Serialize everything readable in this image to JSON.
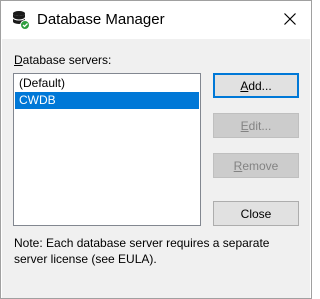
{
  "window": {
    "title": "Database Manager",
    "app_icon": "database-icon",
    "close_icon": "close-icon"
  },
  "servers": {
    "label": "Database servers:",
    "items": [
      {
        "label": "(Default)",
        "selected": false
      },
      {
        "label": "CWDB",
        "selected": true
      }
    ]
  },
  "buttons": {
    "add_label": "Add...",
    "edit_label": "Edit...",
    "remove_label": "Remove",
    "close_label": "Close"
  },
  "note": "Note: Each database server requires a separate server license (see EULA).",
  "colors": {
    "selection": "#0078d7",
    "dialog_bg": "#f0f0f0",
    "disabled_text": "#838383"
  }
}
